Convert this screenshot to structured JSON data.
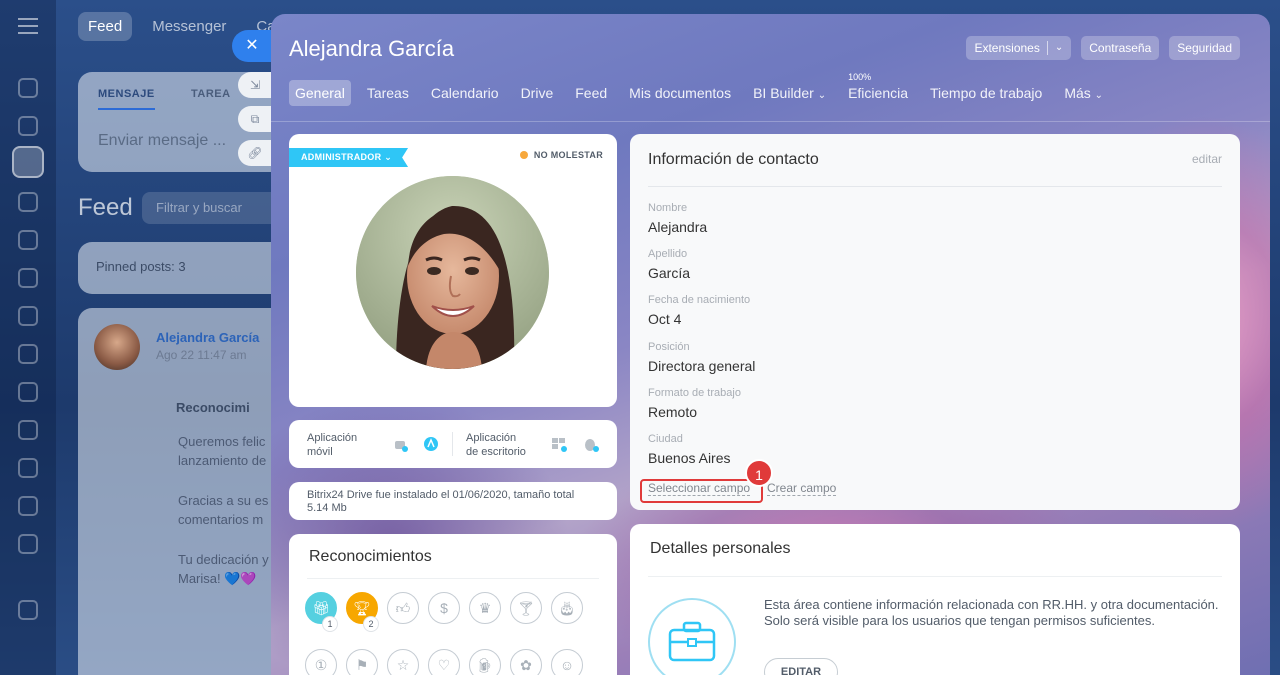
{
  "background": {
    "tabs": [
      "Feed",
      "Messenger",
      "Calendario"
    ],
    "composer": {
      "tab_message": "MENSAJE",
      "tab_task": "TAREA",
      "placeholder": "Enviar mensaje ..."
    },
    "feed_title": "Feed",
    "filter_placeholder": "Filtrar y buscar",
    "pinned": "Pinned posts: 3",
    "post": {
      "author": "Alejandra García",
      "date": "Ago 22 11:47 am",
      "lines": [
        "Reconocimi",
        "Queremos felic",
        "lanzamiento de",
        "Gracias a su es",
        "comentarios m",
        "Tu dedicación y",
        "Marisa! 💙💜"
      ]
    },
    "close_icon": "close-icon"
  },
  "slider": {
    "title": "Alejandra García",
    "header_buttons": {
      "extensions": "Extensiones",
      "password": "Contraseña",
      "security": "Seguridad"
    },
    "tabs": [
      "General",
      "Tareas",
      "Calendario",
      "Drive",
      "Feed",
      "Mis documentos",
      "BI Builder",
      "Eficiencia",
      "Tiempo de trabajo",
      "Más"
    ],
    "efficiency_value": "100%",
    "active_tab": "General"
  },
  "profile": {
    "role_badge": "ADMINISTRADOR",
    "status": "NO MOLESTAR",
    "status_color": "#f7a83c"
  },
  "apps": {
    "mobile_label_1": "Aplicación",
    "mobile_label_2": "móvil",
    "desktop_label_1": "Aplicación",
    "desktop_label_2": "de escritorio"
  },
  "drive_info": "Bitrix24 Drive fue instalado el 01/06/2020, tamaño total 5.14 Mb",
  "recognitions": {
    "title": "Reconocimientos",
    "counts": [
      "1",
      "2"
    ]
  },
  "contact": {
    "title": "Información de contacto",
    "edit": "editar",
    "fields": [
      {
        "label": "Nombre",
        "value": "Alejandra"
      },
      {
        "label": "Apellido",
        "value": "García"
      },
      {
        "label": "Fecha de nacimiento",
        "value": "Oct 4"
      },
      {
        "label": "Posición",
        "value": "Directora general"
      },
      {
        "label": "Formato de trabajo",
        "value": "Remoto"
      },
      {
        "label": "Ciudad",
        "value": "Buenos Aires"
      }
    ],
    "select_field": "Seleccionar campo",
    "create_field": "Crear campo",
    "marker": "1"
  },
  "personal": {
    "title": "Detalles personales",
    "text": "Esta área contiene información relacionada con RR.HH. y otra documentación. Solo será visible para los usuarios que tengan permisos suficientes.",
    "button": "EDITAR"
  }
}
